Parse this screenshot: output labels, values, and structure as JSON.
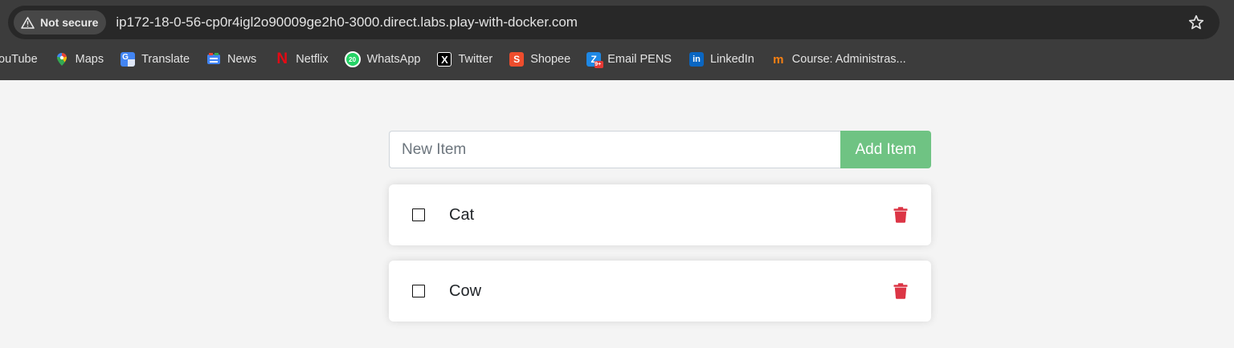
{
  "browser": {
    "security_label": "Not secure",
    "url": "ip172-18-0-56-cp0r4igl2o90009ge2h0-3000.direct.labs.play-with-docker.com",
    "bookmarks": [
      {
        "label": "ouTube",
        "icon": "youtube-icon"
      },
      {
        "label": "Maps",
        "icon": "maps-icon"
      },
      {
        "label": "Translate",
        "icon": "translate-icon"
      },
      {
        "label": "News",
        "icon": "news-icon"
      },
      {
        "label": "Netflix",
        "icon": "netflix-icon"
      },
      {
        "label": "WhatsApp",
        "icon": "whatsapp-icon"
      },
      {
        "label": "Twitter",
        "icon": "twitter-x-icon"
      },
      {
        "label": "Shopee",
        "icon": "shopee-icon"
      },
      {
        "label": "Email PENS",
        "icon": "zimbra-icon"
      },
      {
        "label": "LinkedIn",
        "icon": "linkedin-icon"
      },
      {
        "label": "Course: Administras...",
        "icon": "moodle-icon"
      }
    ]
  },
  "app": {
    "new_item_placeholder": "New Item",
    "add_button_label": "Add Item",
    "items": [
      {
        "name": "Cat",
        "completed": false
      },
      {
        "name": "Cow",
        "completed": false
      }
    ]
  },
  "colors": {
    "add_button": "#6fc383",
    "delete_icon": "#dc3545",
    "page_background": "#f4f4f4",
    "chrome_background": "#3c3c3c"
  }
}
